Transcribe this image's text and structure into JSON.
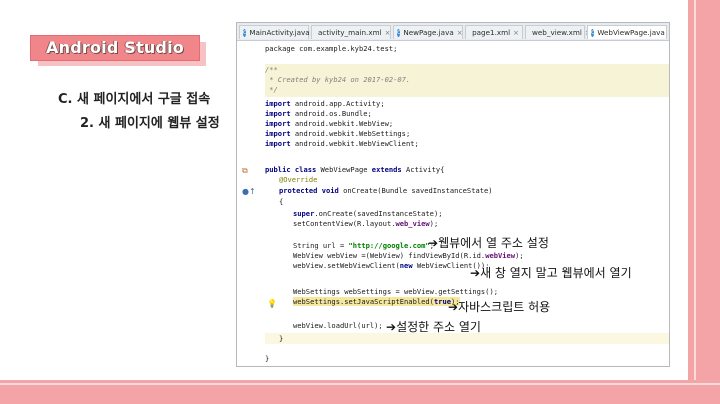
{
  "title_badge": "Android Studio",
  "heading_c": "C. 새 페이지에서 구글 접속",
  "heading_2": "2. 새 페이지에 웹뷰 설정",
  "tabs": [
    {
      "label": "MainActivity.java",
      "icon": "c-class-icon"
    },
    {
      "label": "activity_main.xml",
      "icon": "xml-icon"
    },
    {
      "label": "NewPage.java",
      "icon": "c-class-icon"
    },
    {
      "label": "page1.xml",
      "icon": "xml-icon"
    },
    {
      "label": "web_view.xml",
      "icon": "xml-icon"
    },
    {
      "label": "WebViewPage.java",
      "icon": "c-class-icon"
    }
  ],
  "code": {
    "package": "package com.example.kyb24.test;",
    "comment_open": "/**",
    "comment_body": " * Created by kyb24 on 2017-02-07.",
    "comment_close": " */",
    "import_kw": "import",
    "imports": [
      "android.app.Activity;",
      "android.os.Bundle;",
      "android.webkit.WebView;",
      "android.webkit.WebSettings;",
      "android.webkit.WebViewClient;"
    ],
    "class_public": "public",
    "class_kw": "class",
    "class_name": " WebViewPage ",
    "class_extends": "extends",
    "class_rest": " Activity{",
    "override": "@Override",
    "method_kw": "protected void",
    "method_rest": " onCreate(Bundle savedInstanceState)",
    "open_brace": "{",
    "super_kw": "super",
    "super_rest": ".onCreate(savedInstanceState);",
    "setcontent_a": "setContentView(R.layout.",
    "setcontent_b": "web_view",
    "setcontent_c": ");",
    "url_a": "String url = ",
    "url_b": "\"http://google.com\"",
    "url_c": ";",
    "webview_a": "WebView webView =(WebView) findViewById(R.id.",
    "webview_b": "webView",
    "webview_c": ");",
    "client_a": "webView.setWebViewClient(",
    "client_b": "new",
    "client_c": " WebViewClient());",
    "settings": "WebSettings webSettings = webView.getSettings();",
    "js_a": "webSettings.setJavaScriptEnabled(",
    "js_b": "true",
    "js_c": ");",
    "load": "webView.loadUrl(url);",
    "close_inner": "}",
    "close_outer": "}"
  },
  "annotations": {
    "arrow": "➔",
    "url": "웹뷰에서 열 주소 설정",
    "client": "새 창 열지 말고 웹뷰에서 열기",
    "js": "자바스크립트 허용",
    "load": "설정한 주소 열기"
  },
  "colors": {
    "accent": "#f0868a",
    "stripe": "#f4a3a6"
  }
}
